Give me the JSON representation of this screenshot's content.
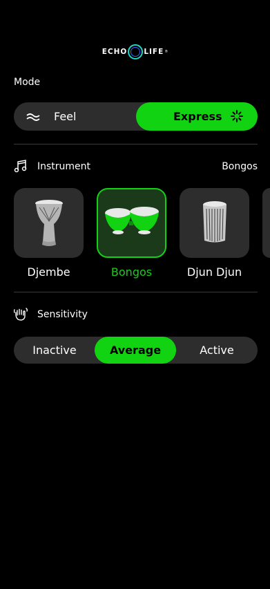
{
  "brand": {
    "part1": "ECHO",
    "part2": "LIFE",
    "reg": "®"
  },
  "mode": {
    "label": "Mode",
    "options": [
      {
        "label": "Feel",
        "icon": "waves-icon",
        "selected": false
      },
      {
        "label": "Express",
        "icon": "sparkle-icon",
        "selected": true
      }
    ]
  },
  "instrument": {
    "label": "Instrument",
    "current": "Bongos",
    "items": [
      {
        "label": "Djembe",
        "icon": "djembe-icon",
        "selected": false
      },
      {
        "label": "Bongos",
        "icon": "bongos-icon",
        "selected": true
      },
      {
        "label": "Djun Djun",
        "icon": "djun-djun-icon",
        "selected": false
      }
    ]
  },
  "sensitivity": {
    "label": "Sensitivity",
    "options": [
      {
        "label": "Inactive",
        "selected": false
      },
      {
        "label": "Average",
        "selected": true
      },
      {
        "label": "Active",
        "selected": false
      }
    ]
  },
  "colors": {
    "accent": "#12d312",
    "surface": "#2d2d2d",
    "background": "#000000"
  }
}
